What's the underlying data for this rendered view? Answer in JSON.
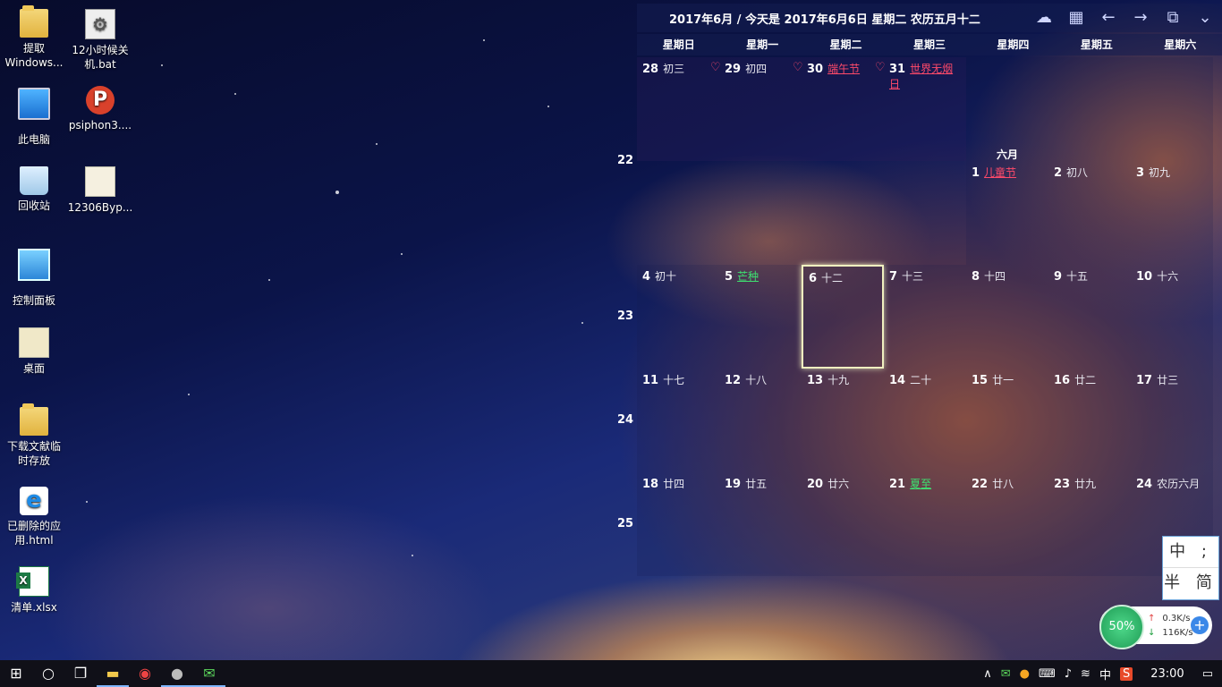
{
  "desktop": {
    "icons": [
      {
        "label": "提取\nWindows...",
        "icon": "folder-icon"
      },
      {
        "label": "12小时候关\n机.bat",
        "icon": "batch-file-icon"
      },
      {
        "label": "此电脑",
        "icon": "computer-icon"
      },
      {
        "label": "psiphon3....",
        "icon": "psiphon-icon"
      },
      {
        "label": "回收站",
        "icon": "recycle-bin-icon"
      },
      {
        "label": "12306Byp...",
        "icon": "folder-icon"
      },
      {
        "label": "控制面板",
        "icon": "control-panel-icon"
      },
      {
        "label": "桌面",
        "icon": "desktop-folder-icon"
      },
      {
        "label": "下载文献临\n时存放",
        "icon": "folder-icon"
      },
      {
        "label": "已删除的应\n用.html",
        "icon": "ie-file-icon"
      },
      {
        "label": "清单.xlsx",
        "icon": "excel-file-icon"
      }
    ]
  },
  "calendar": {
    "title": "2017年6月 / 今天是 2017年6月6日 星期二 农历五月十二",
    "weekdays": [
      "星期日",
      "星期一",
      "星期二",
      "星期三",
      "星期四",
      "星期五",
      "星期六"
    ],
    "week_numbers": [
      "22",
      "23",
      "24",
      "25"
    ],
    "month_label": "六月",
    "rows": [
      [
        {
          "day": "28",
          "lunar": "初三",
          "tag": "♡"
        },
        {
          "day": "29",
          "lunar": "初四",
          "tag": "♡"
        },
        {
          "day": "30",
          "lunar": "端午节",
          "tag": "♡"
        },
        {
          "day": "31",
          "lunar": "世界无烟日"
        },
        {
          "day": "1",
          "lunar": "儿童节"
        },
        {
          "day": "2",
          "lunar": "初八"
        },
        {
          "day": "3",
          "lunar": "初九"
        }
      ],
      [
        {
          "day": "4",
          "lunar": "初十"
        },
        {
          "day": "5",
          "lunar": "芒种"
        },
        {
          "day": "6",
          "lunar": "十二"
        },
        {
          "day": "7",
          "lunar": "十三"
        },
        {
          "day": "8",
          "lunar": "十四"
        },
        {
          "day": "9",
          "lunar": "十五"
        },
        {
          "day": "10",
          "lunar": "十六"
        }
      ],
      [
        {
          "day": "11",
          "lunar": "十七"
        },
        {
          "day": "12",
          "lunar": "十八"
        },
        {
          "day": "13",
          "lunar": "十九"
        },
        {
          "day": "14",
          "lunar": "二十"
        },
        {
          "day": "15",
          "lunar": "廿一"
        },
        {
          "day": "16",
          "lunar": "廿二"
        },
        {
          "day": "17",
          "lunar": "廿三"
        }
      ],
      [
        {
          "day": "18",
          "lunar": "廿四"
        },
        {
          "day": "19",
          "lunar": "廿五"
        },
        {
          "day": "20",
          "lunar": "廿六"
        },
        {
          "day": "21",
          "lunar": "夏至"
        },
        {
          "day": "22",
          "lunar": "廿八"
        },
        {
          "day": "23",
          "lunar": "廿九"
        },
        {
          "day": "24",
          "lunar": "农历六月"
        }
      ]
    ],
    "today_index": [
      1,
      2
    ],
    "colors": {
      "festival_red": "#ff4a6a",
      "solar_term_green": "#3ee070"
    }
  },
  "ime": {
    "row1": "中 ;",
    "row2": "半 简"
  },
  "net_monitor": {
    "percent": "50%",
    "upload": "0.3K/s",
    "download": "116K/s"
  },
  "taskbar": {
    "tray_ime": "中",
    "clock": "23:00"
  }
}
